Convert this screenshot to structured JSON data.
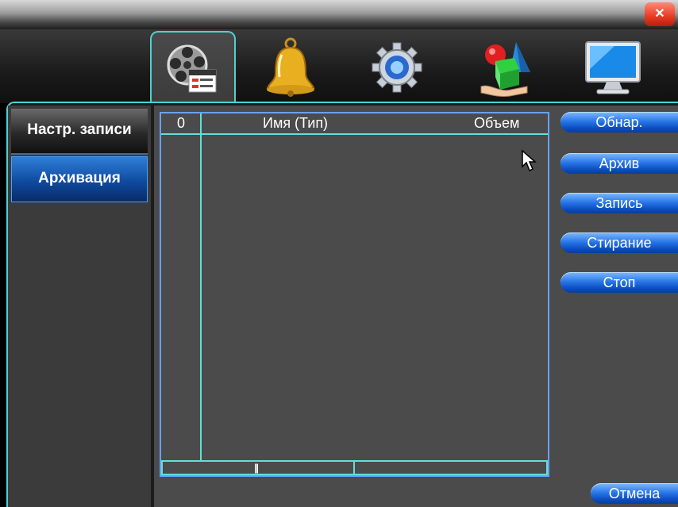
{
  "window": {
    "close_glyph": "✕"
  },
  "tabs": [
    {
      "name": "record",
      "icon": "film-reel-icon",
      "active": true
    },
    {
      "name": "alarm",
      "icon": "bell-icon",
      "active": false
    },
    {
      "name": "system",
      "icon": "gear-icon",
      "active": false
    },
    {
      "name": "advanced",
      "icon": "shapes-icon",
      "active": false
    },
    {
      "name": "info",
      "icon": "monitor-icon",
      "active": false
    }
  ],
  "sidebar": {
    "items": [
      {
        "label": "Настр. записи",
        "active": false
      },
      {
        "label": "Архивация",
        "active": true
      }
    ]
  },
  "table": {
    "columns": [
      "0",
      "Имя (Тип)",
      "Объем"
    ],
    "rows": []
  },
  "actions": {
    "detect": "Обнар.",
    "archive": "Архив",
    "record": "Запись",
    "erase": "Стирание",
    "stop": "Стоп",
    "cancel": "Отмена"
  },
  "colors": {
    "accent_cyan": "#4fd0d0",
    "button_blue": "#2a78e8",
    "panel_gray": "#4b4b4b"
  }
}
